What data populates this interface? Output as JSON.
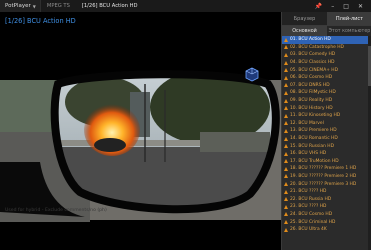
{
  "topbar": {
    "app_label": "PotPlayer",
    "tabs": [
      "MPEG TS",
      "[1/26] BCU Action HD"
    ],
    "controls": [
      "pin-icon",
      "minimize-icon",
      "maximize-icon",
      "close-icon"
    ]
  },
  "video": {
    "osd_title": "[1/26] BCU Action HD",
    "hint": "Used for hybrid - Exclude comments/no (ph)"
  },
  "panel": {
    "tabs": [
      "Браузер",
      "Плей-лист"
    ],
    "active_tab": 1,
    "subtabs": [
      "Основной",
      "Этот компьютер"
    ],
    "active_subtab": 0,
    "items": [
      "01. BCU Action HD",
      "02. BCU Catastrophe HD",
      "03. BCU Comedy HD",
      "04. BCU Classics HD",
      "05. BCU CINEMA+ HD",
      "06. BCU Cosmo HD",
      "07. BCU DNRS HD",
      "08. BCU FilMystic HD",
      "09. BCU Reality HD",
      "10. BCU History HD",
      "11. BCU Kinoseting HD",
      "12. BCU Marvel",
      "13. BCU Premiere HD",
      "14. BCU Romantic HD",
      "15. BCU Russian HD",
      "16. BCU VHS HD",
      "17. BCU TruMotion HD",
      "18. BCU ?????? Premiere 1 HD",
      "19. BCU ?????? Premiere 2 HD",
      "20. BCU ?????? Premiere 3 HD",
      "21. BCU ???? HD",
      "22. BCU Russia HD",
      "23. BCU ???? HD",
      "24. BCU Cosmo HD",
      "25. BCU Criminal HD",
      "26. BCU Ultra 4K"
    ],
    "selected_index": 0
  },
  "colors": {
    "accent": "#2f63b5",
    "osd_text": "#3f8fe3",
    "item_text": "#e0a44a"
  }
}
